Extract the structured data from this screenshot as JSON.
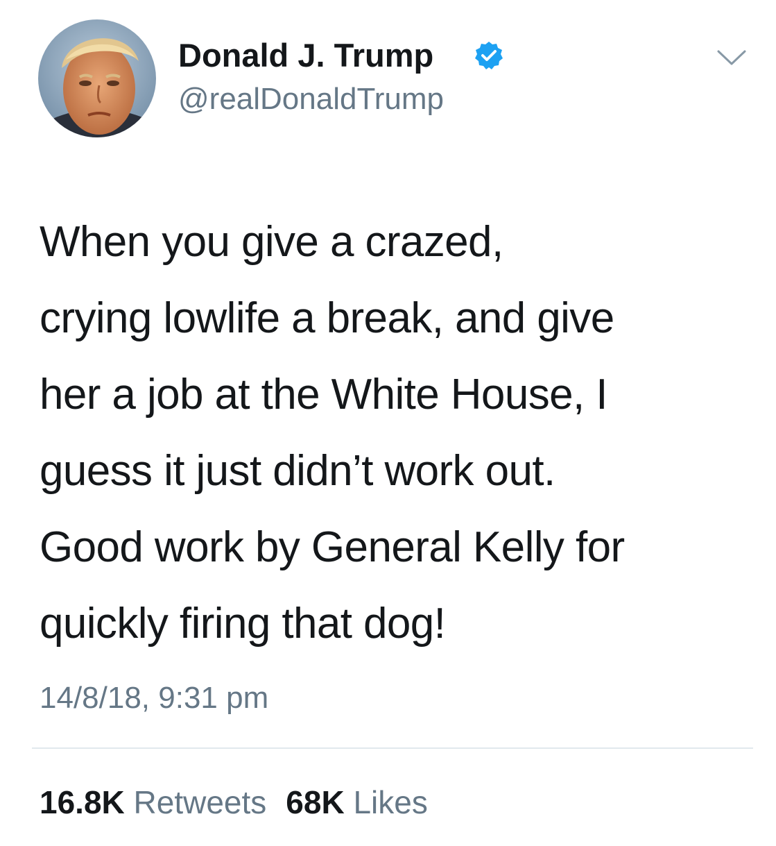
{
  "user": {
    "display_name": "Donald J. Trump",
    "handle": "@realDonaldTrump",
    "verified_icon": "verified-badge-icon",
    "verified_color": "#1da1f2"
  },
  "tweet": {
    "lines": [
      "When you give a crazed,",
      "crying lowlife a break, and give",
      "her a job at the White House, I",
      "guess it just didn’t work out.",
      "Good work by General Kelly for",
      "quickly firing that dog!"
    ],
    "timestamp": "14/8/18, 9:31 pm"
  },
  "stats": {
    "retweets_count": "16.8K",
    "retweets_label": "Retweets",
    "likes_count": "68K",
    "likes_label": "Likes"
  },
  "colors": {
    "text": "#14171a",
    "secondary": "#657786",
    "divider": "#e1e8ed"
  }
}
